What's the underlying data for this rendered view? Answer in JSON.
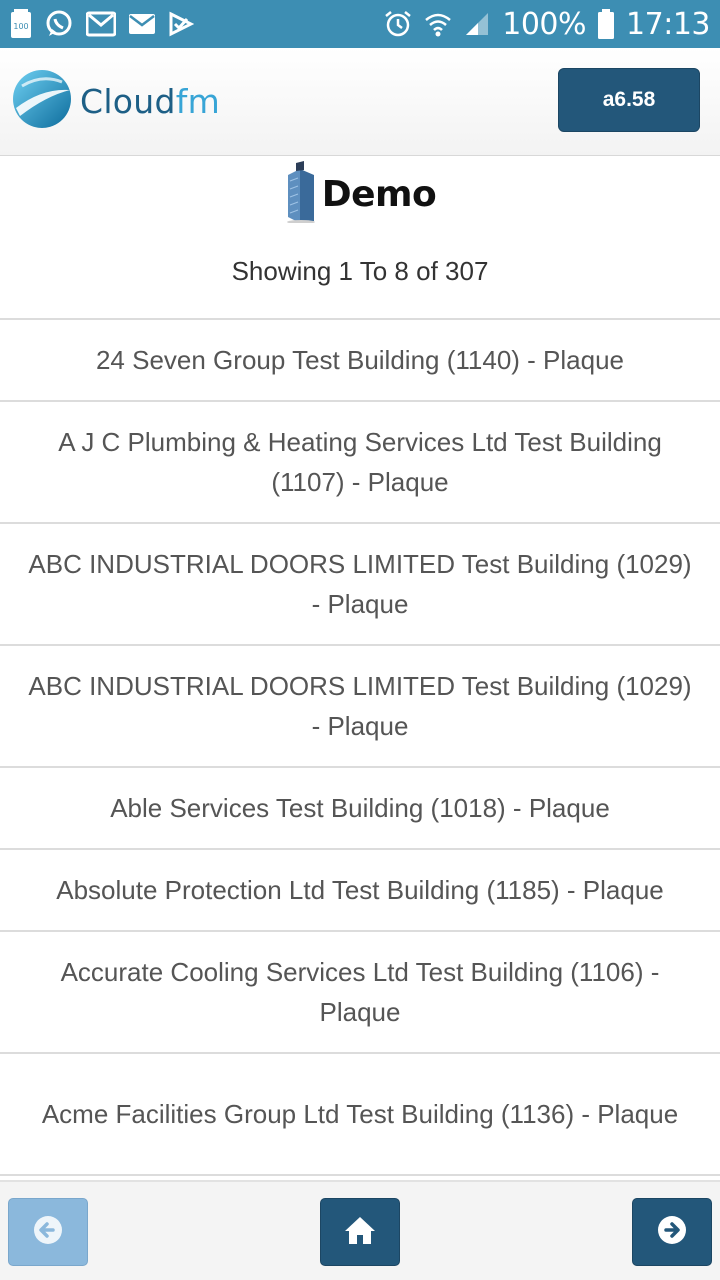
{
  "status_bar": {
    "battery_saver_label": "100",
    "battery_percent": "100%",
    "time": "17:13",
    "icons": [
      "battery-saver-icon",
      "whatsapp-icon",
      "gmail-icon",
      "mail-icon",
      "task-icon",
      "alarm-icon",
      "wifi-icon",
      "signal-icon",
      "battery-icon"
    ]
  },
  "header": {
    "logo_text_main": "Cloud",
    "logo_text_accent": "fm",
    "version_label": "a6.58"
  },
  "company": {
    "name": "Demo",
    "icon": "building-icon"
  },
  "pagination": {
    "showing_text": "Showing 1 To 8 of 307"
  },
  "buildings": [
    {
      "label": "24 Seven Group Test Building (1140) - Plaque"
    },
    {
      "label": "A J C Plumbing & Heating Services Ltd Test Building (1107) - Plaque"
    },
    {
      "label": "ABC INDUSTRIAL DOORS LIMITED Test Building (1029) - Plaque"
    },
    {
      "label": "ABC INDUSTRIAL DOORS LIMITED Test Building (1029) - Plaque"
    },
    {
      "label": "Able Services Test Building (1018) - Plaque"
    },
    {
      "label": "Absolute Protection Ltd Test Building (1185) - Plaque"
    },
    {
      "label": "Accurate Cooling Services Ltd Test Building (1106) - Plaque"
    },
    {
      "label": "Acme Facilities Group Ltd Test Building (1136) - Plaque"
    }
  ],
  "footer": {
    "prev_icon": "arrow-left-circle-icon",
    "home_icon": "home-icon",
    "next_icon": "arrow-right-circle-icon",
    "prev_disabled": true
  },
  "colors": {
    "status_bar": "#3d8eb3",
    "primary_button": "#23577a",
    "disabled_button": "#8bb8dc"
  }
}
